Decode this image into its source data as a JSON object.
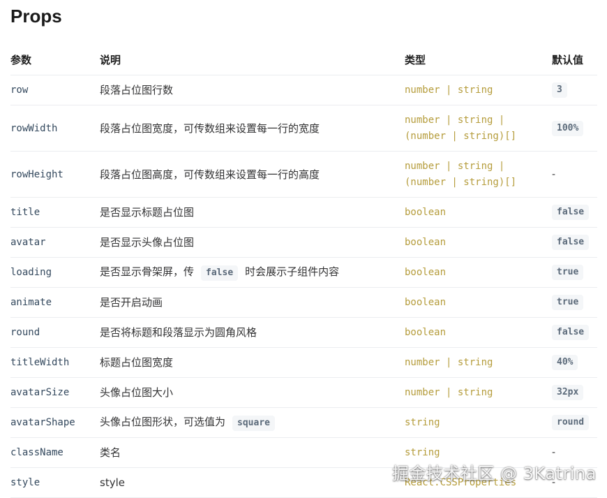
{
  "title": "Props",
  "headers": {
    "param": "参数",
    "desc": "说明",
    "type": "类型",
    "default": "默认值"
  },
  "rows": [
    {
      "name": "row",
      "desc": "段落占位图行数",
      "type": "number | string",
      "default": "3"
    },
    {
      "name": "rowWidth",
      "desc": "段落占位图宽度，可传数组来设置每一行的宽度",
      "type_line1": "number | string |",
      "type_line2": "(number | string)[]",
      "default": "100%"
    },
    {
      "name": "rowHeight",
      "desc": "段落占位图高度，可传数组来设置每一行的高度",
      "type_line1": "number | string |",
      "type_line2": "(number | string)[]",
      "default": "-"
    },
    {
      "name": "title",
      "desc": "是否显示标题占位图",
      "type": "boolean",
      "default": "false"
    },
    {
      "name": "avatar",
      "desc": "是否显示头像占位图",
      "type": "boolean",
      "default": "false"
    },
    {
      "name": "loading",
      "desc_before": "是否显示骨架屏，传",
      "desc_code": "false",
      "desc_after": "时会展示子组件内容",
      "type": "boolean",
      "default": "true"
    },
    {
      "name": "animate",
      "desc": "是否开启动画",
      "type": "boolean",
      "default": "true"
    },
    {
      "name": "round",
      "desc": "是否将标题和段落显示为圆角风格",
      "type": "boolean",
      "default": "false"
    },
    {
      "name": "titleWidth",
      "desc": "标题占位图宽度",
      "type": "number | string",
      "default": "40%"
    },
    {
      "name": "avatarSize",
      "desc": "头像占位图大小",
      "type": "number | string",
      "default": "32px"
    },
    {
      "name": "avatarShape",
      "desc_before": "头像占位图形状，可选值为",
      "desc_code": "square",
      "type": "string",
      "default": "round"
    },
    {
      "name": "className",
      "desc": "类名",
      "type": "string",
      "default": "-"
    },
    {
      "name": "style",
      "desc": "style",
      "type": "React.CSSProperties",
      "default": "-"
    }
  ],
  "watermark": "掘金技术社区 @ 3Katrina",
  "colors": {
    "type_text": "#b59c3b",
    "name_text": "#34495e",
    "code_bg": "#f4f6f8",
    "code_text": "#5b6a7a",
    "row_border": "#ebedf0"
  }
}
